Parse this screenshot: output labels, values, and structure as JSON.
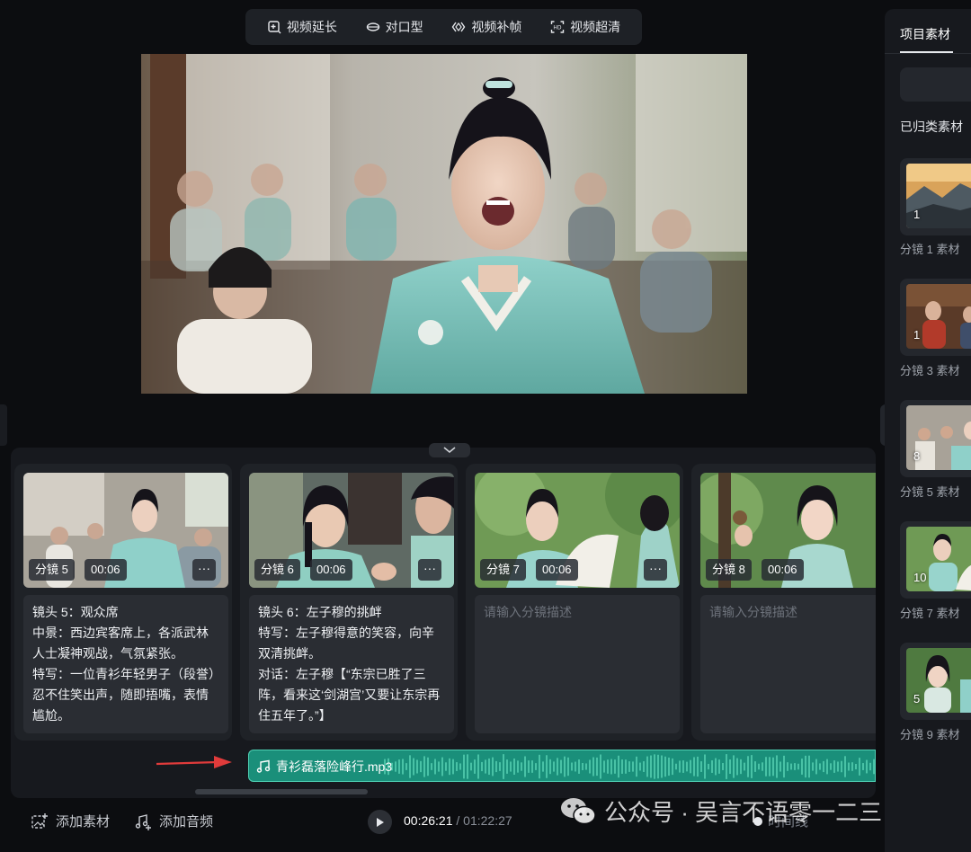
{
  "toolbar": {
    "items": [
      {
        "label": "视频延长",
        "icon": "video-extend-icon"
      },
      {
        "label": "对口型",
        "icon": "lip-sync-icon"
      },
      {
        "label": "视频补帧",
        "icon": "frame-interpolation-icon"
      },
      {
        "label": "视频超清",
        "icon": "super-resolution-icon"
      }
    ]
  },
  "storyboard": {
    "cards": [
      {
        "shot": "分镜 5",
        "duration": "00:06",
        "more": "···",
        "description": "镜头 5：观众席\n中景：西边宾客席上，各派武林人士凝神观战，气氛紧张。\n特写：一位青衫年轻男子（段誉）忍不住笑出声，随即捂嘴，表情尴尬。"
      },
      {
        "shot": "分镜 6",
        "duration": "00:06",
        "more": "···",
        "description": "镜头 6：左子穆的挑衅\n特写：左子穆得意的笑容，向辛双清挑衅。\n对话：左子穆【“东宗已胜了三阵，看来这‘剑湖宫’又要让东宗再住五年了。”】"
      },
      {
        "shot": "分镜 7",
        "duration": "00:06",
        "more": "···",
        "placeholder": "请输入分镜描述"
      },
      {
        "shot": "分镜 8",
        "duration": "00:06",
        "more": "···",
        "placeholder": "请输入分镜描述"
      }
    ]
  },
  "audio": {
    "filename": "青衫磊落险峰行.mp3"
  },
  "bottom": {
    "add_material": "添加素材",
    "add_audio": "添加音频",
    "current_time": "00:26:21",
    "separator": " / ",
    "total_time": "01:22:27",
    "faded_label": "时间线"
  },
  "watermark": {
    "text": "公众号 · 吴言不语零一二三"
  },
  "right_panel": {
    "tab": "项目素材",
    "section": "已归类素材",
    "items": [
      {
        "count": "1",
        "label": "分镜 1 素材"
      },
      {
        "count": "1",
        "label": "分镜 3 素材"
      },
      {
        "count": "8",
        "label": "分镜 5 素材"
      },
      {
        "count": "10",
        "label": "分镜 7 素材"
      },
      {
        "count": "5",
        "label": "分镜 9 素材"
      }
    ]
  },
  "colors": {
    "accent_audio": "#1a8f7a",
    "panel": "#17191e",
    "card": "#1f2227",
    "robe": "#7fc4bd"
  }
}
